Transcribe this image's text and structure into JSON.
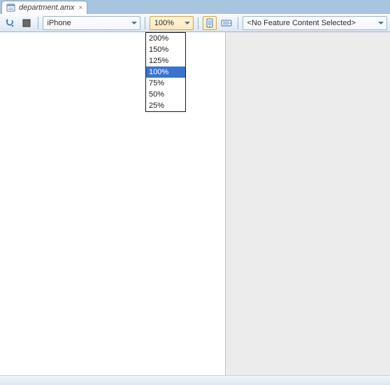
{
  "tab": {
    "filename": "department.amx"
  },
  "toolbar": {
    "device": {
      "value": "iPhone"
    },
    "zoom": {
      "value": "100%"
    },
    "feature_content": {
      "value": "<No Feature Content Selected>"
    }
  },
  "zoom_menu": {
    "options": [
      "200%",
      "150%",
      "125%",
      "100%",
      "75%",
      "50%",
      "25%"
    ],
    "selected": "100%"
  }
}
